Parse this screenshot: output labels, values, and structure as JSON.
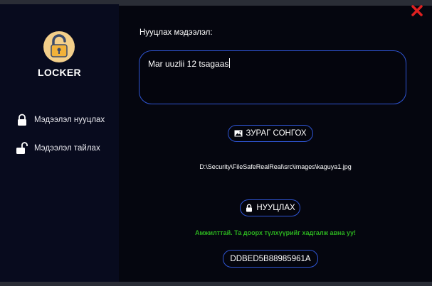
{
  "sidebar": {
    "app_title": "LOCKER",
    "logo_icon": "padlock-logo-icon",
    "items": [
      {
        "label": "Мэдээлэл нууцлах",
        "icon": "lock-closed-icon"
      },
      {
        "label": "Мэдээлэл тайлах",
        "icon": "lock-open-icon"
      }
    ]
  },
  "main": {
    "field_label": "Нууцлах мэдээлэл:",
    "message_value": "Mar uuzlii 12 tsagaas",
    "choose_image_label": "ЗУРАГ СОНГОХ",
    "choose_image_icon": "image-icon",
    "file_path": "D:\\Security\\FileSafeRealReal\\src\\images\\kaguya1.jpg",
    "encrypt_label": "НУУЦЛАХ",
    "encrypt_icon": "lock-icon",
    "status_message": "Амжилттай. Та доорх түлхүүрийг хадгалж авна уу!",
    "key_value": "DDBED5B88985961A"
  },
  "colors": {
    "background": "#05060f",
    "sidebar": "#080b1e",
    "accent_border": "#2f55d4",
    "success": "#2bb01f",
    "close": "#e02020"
  }
}
